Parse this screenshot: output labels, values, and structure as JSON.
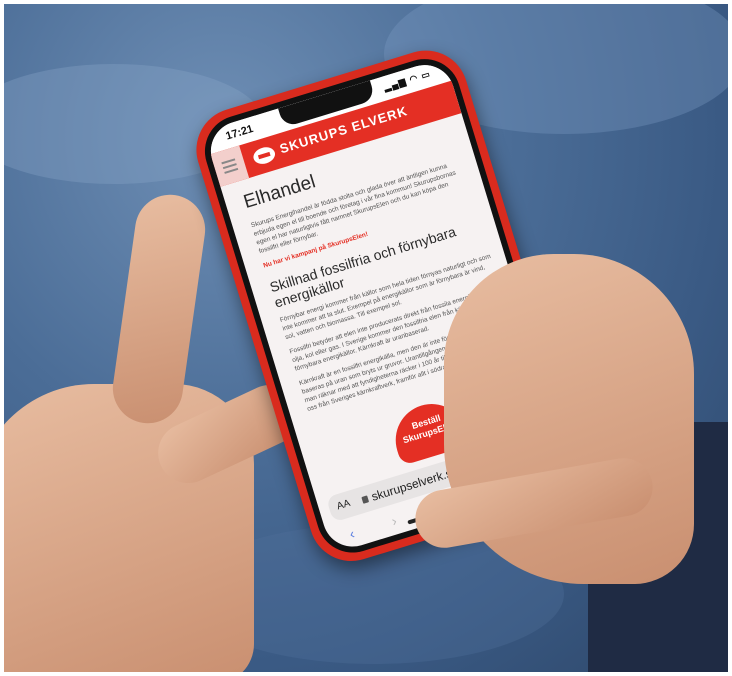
{
  "status": {
    "time": "17:21",
    "icons": "▂▄▆ ◠ ▭"
  },
  "header": {
    "logo": "SKURUPS ELVERK"
  },
  "content": {
    "title": "Elhandel",
    "intro": "Skurups Energihandel är födda stolta och glada över att äntligen kunna erbjuda egen el till boende och företag i vår fina kommun! Skurupsbornas egen el har naturligtvis fått namnet SkurupsElen och du kan köpa den fossilfri eller förnybar.",
    "campaign": "Nu har vi kampanj på SkurupsElen!",
    "subtitle": "Skillnad fossilfria och förnybara energikällor",
    "para1": "Förnybar energi kommer från källor som hela tiden förnyas naturligt och som inte kommer att ta slut. Exempel på energikällor som är förnybara är vind, sol, vatten och biomassa. Till exempel sol.",
    "para2": "Fossilfri betyder att elen inte producerats direkt från fossila energikällor som olja, kol eller gas. I Sverige kommer den fossilfria elen från kärnkraft och förnybara energikällor. Kärnkraft är uranbaserad.",
    "para3": "Kärnkraft är en fossilfri energikälla, men den är inte förnybar. Kärnkraft baseras på uran som bryts ur gruvor. Urantillgången är begränsad, men man räknar med att fyndigheterna räcker i 100 år till. Elen kommer inte till oss från Sveriges kärnkraftverk, framför allt i södra Sverige."
  },
  "cta": {
    "label": "Beställ SkurupsElen"
  },
  "browser": {
    "aa": "AA",
    "url": "skurupselverk.se",
    "reload": "↻",
    "back": "‹",
    "forward": "›"
  }
}
